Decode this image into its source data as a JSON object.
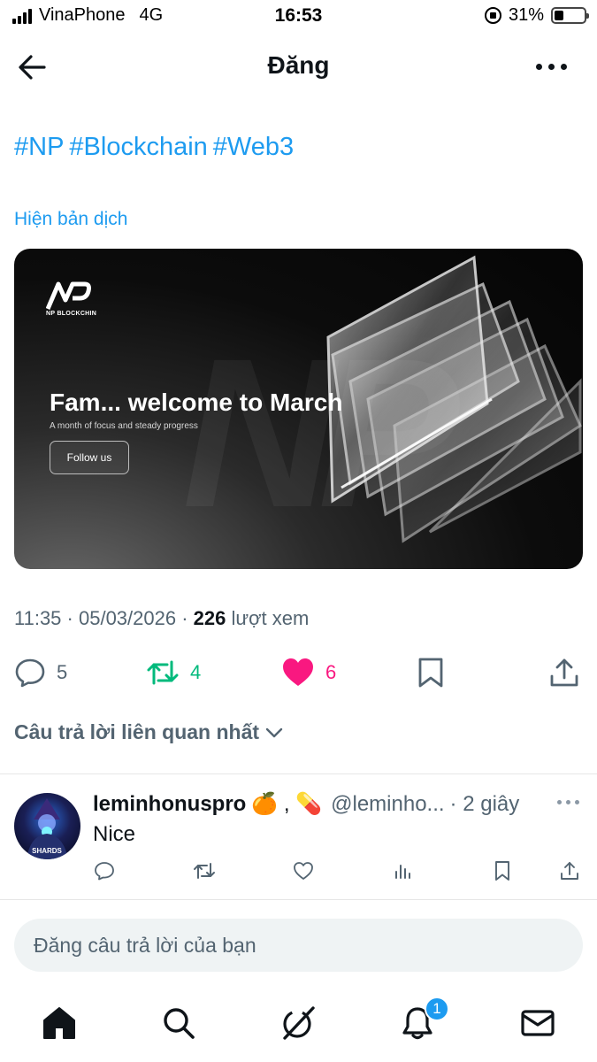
{
  "status_bar": {
    "carrier": "VinaPhone",
    "network": "4G",
    "time": "16:53",
    "battery": "31%",
    "battery_level": 0.31
  },
  "header": {
    "title": "Đăng"
  },
  "post": {
    "hashtags": [
      "#NP",
      "#Blockchain",
      "#Web3"
    ],
    "translate_label": "Hiện bản dịch",
    "banner": {
      "logo_text": "NP BLOCKCHIN",
      "headline": "Fam... welcome to March",
      "subline": "A month of focus and steady progress",
      "button": "Follow us"
    },
    "meta": {
      "time": "11:35",
      "date": "05/03/2026",
      "views": "226",
      "views_label": "lượt xem"
    },
    "stats": {
      "replies": "5",
      "reposts": "4",
      "likes": "6"
    },
    "colors": {
      "accent": "#1d9bf0",
      "repost": "#00ba7c",
      "like": "#f91880",
      "muted": "#536471"
    }
  },
  "replies_section": {
    "sort_label": "Câu trả lời liên quan nhất",
    "items": [
      {
        "name": "leminhonuspro",
        "emoji_text": "🍊 , 💊",
        "handle": "@leminho...",
        "time": "· 2 giây",
        "text": "Nice",
        "avatar_label": "SHARDS"
      }
    ]
  },
  "compose": {
    "placeholder": "Đăng câu trả lời của bạn"
  },
  "bottom_nav": {
    "items": [
      "home-icon",
      "search-icon",
      "grok-icon",
      "notifications-icon",
      "messages-icon"
    ],
    "notification_badge": "1"
  }
}
